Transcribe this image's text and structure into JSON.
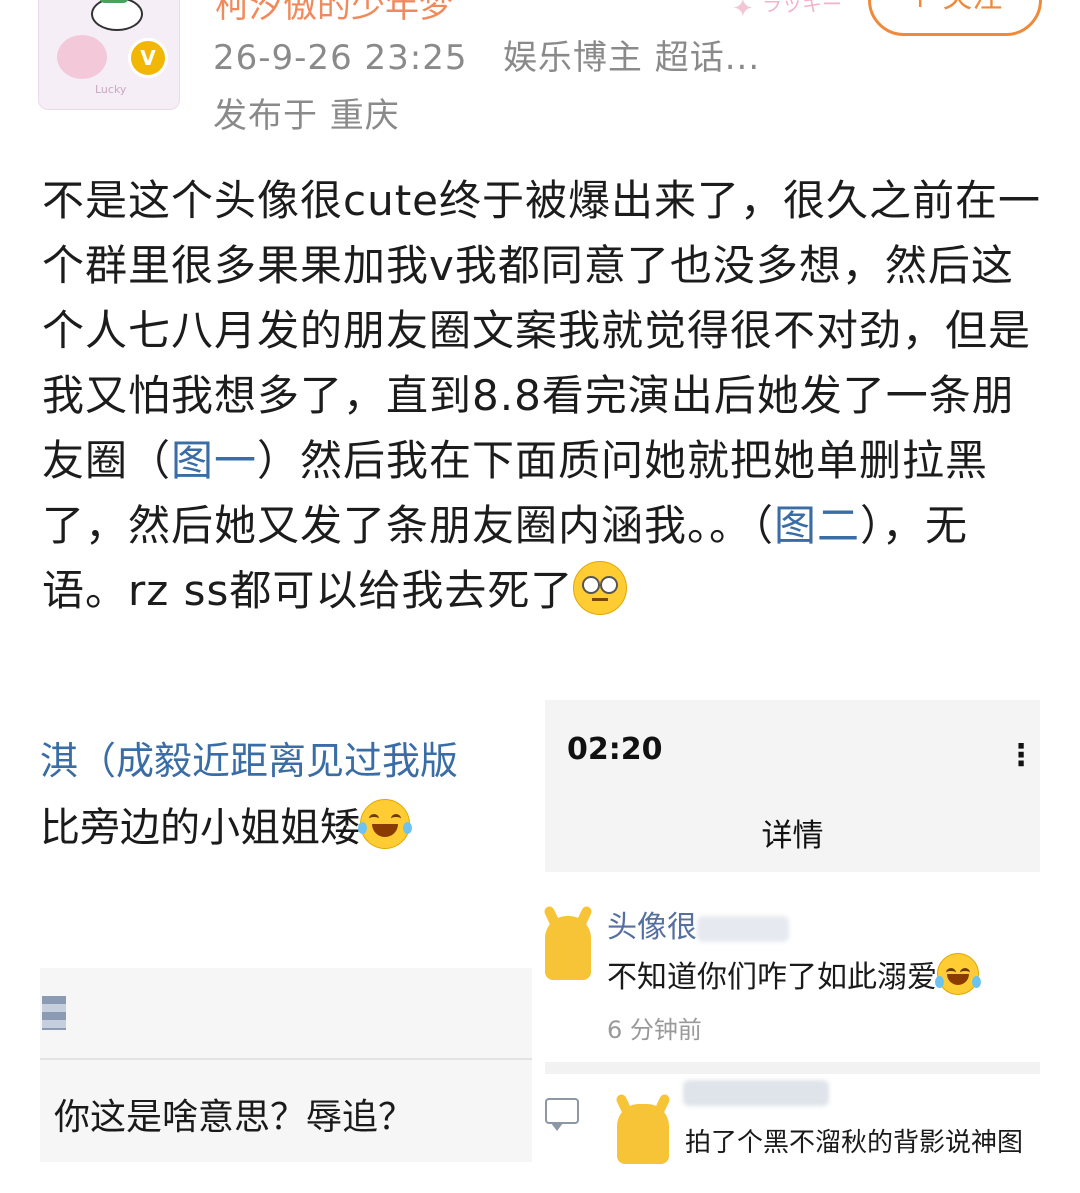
{
  "header": {
    "username": "柯汐傲的少年梦",
    "follow_label": "+ 关注",
    "timestamp": "26-9-26 23:25",
    "tags": "娱乐博主 超话...",
    "location": "发布于 重庆",
    "avatar_caption": "Lucky",
    "deco_text": "ラッキー"
  },
  "post": {
    "text_before_link1": "不是这个头像很cute终于被爆出来了，很久之前在一个群里很多果果加我v我都同意了也没多想，然后这个人七八月发的朋友圈文案我就觉得很不对劲，但是我又怕我想多了，直到8.8看完演出后她发了一条朋友圈（",
    "link1": "图一",
    "text_between": "）然后我在下面质问她就把她单删拉黑了，然后她又发了条朋友圈内涵我。。（",
    "link2": "图二",
    "text_after": "），无语。rz ss都可以给我去死了",
    "emoji": "eye-roll"
  },
  "left_screenshot": {
    "line1": "淇（成毅近距离见过我版",
    "line2": "比旁边的小姐姐矮",
    "chat_message": "你这是啥意思？辱追？"
  },
  "right_screenshot": {
    "time": "02:20",
    "more": "⋮",
    "title": "详情",
    "comment1_name": "头像很",
    "comment1_text": "不知道你们咋了如此溺爱",
    "comment1_time": "6 分钟前",
    "comment2_text": "拍了个黑不溜秋的背影说神图"
  },
  "colors": {
    "link": "#3a6da6",
    "follow_accent": "#f08a3a",
    "meta_gray": "#8a8a8a",
    "verified_badge": "#f2b705"
  }
}
